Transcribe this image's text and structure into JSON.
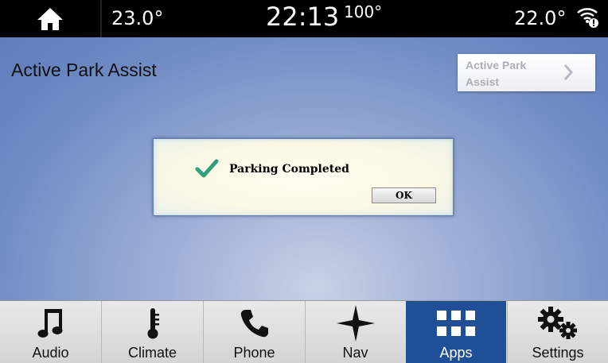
{
  "status_bar": {
    "temp_left": "23.0°",
    "clock": "22:13",
    "outside_temp": "100°",
    "temp_right": "22.0°"
  },
  "page": {
    "title": "Active Park Assist",
    "breadcrumb_label": "Active Park Assist"
  },
  "dialog": {
    "message": "Parking Completed",
    "ok_label": "OK"
  },
  "nav": {
    "items": [
      {
        "label": "Audio",
        "icon": "music-note-icon"
      },
      {
        "label": "Climate",
        "icon": "thermometer-icon"
      },
      {
        "label": "Phone",
        "icon": "phone-icon"
      },
      {
        "label": "Nav",
        "icon": "compass-star-icon"
      },
      {
        "label": "Apps",
        "icon": "apps-grid-icon",
        "active": true
      },
      {
        "label": "Settings",
        "icon": "gears-icon"
      }
    ]
  },
  "colors": {
    "accent_active": "#1f4f97",
    "check_green": "#2fa07a"
  }
}
